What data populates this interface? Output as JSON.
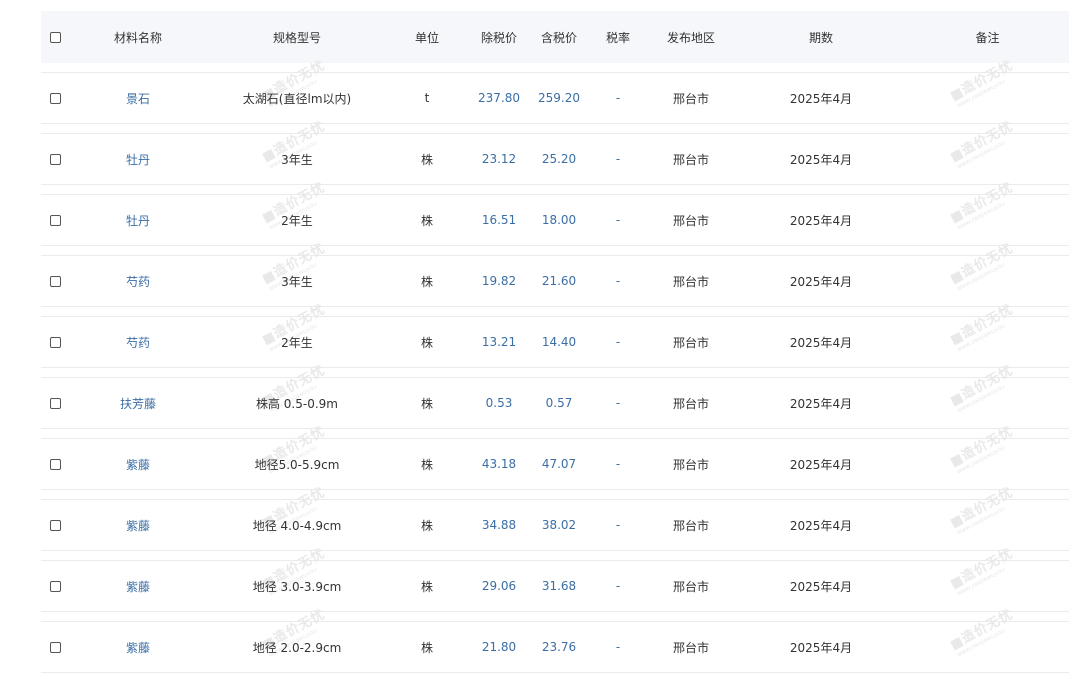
{
  "table": {
    "headers": {
      "name": "材料名称",
      "spec": "规格型号",
      "unit": "单位",
      "price_ex_tax": "除税价",
      "price_in_tax": "含税价",
      "tax_rate": "税率",
      "area": "发布地区",
      "period": "期数",
      "note": "备注"
    },
    "watermark_text": "造价无忧",
    "watermark_sub": "www.zaojiawuyou",
    "rows": [
      {
        "name": "景石",
        "spec": "太湖石(直径lm以内)",
        "unit": "t",
        "price_ex_tax": "237.80",
        "price_in_tax": "259.20",
        "tax_rate": "-",
        "area": "邢台市",
        "period": "2025年4月",
        "note": ""
      },
      {
        "name": "牡丹",
        "spec": "3年生",
        "unit": "株",
        "price_ex_tax": "23.12",
        "price_in_tax": "25.20",
        "tax_rate": "-",
        "area": "邢台市",
        "period": "2025年4月",
        "note": ""
      },
      {
        "name": "牡丹",
        "spec": "2年生",
        "unit": "株",
        "price_ex_tax": "16.51",
        "price_in_tax": "18.00",
        "tax_rate": "-",
        "area": "邢台市",
        "period": "2025年4月",
        "note": ""
      },
      {
        "name": "芍药",
        "spec": "3年生",
        "unit": "株",
        "price_ex_tax": "19.82",
        "price_in_tax": "21.60",
        "tax_rate": "-",
        "area": "邢台市",
        "period": "2025年4月",
        "note": ""
      },
      {
        "name": "芍药",
        "spec": "2年生",
        "unit": "株",
        "price_ex_tax": "13.21",
        "price_in_tax": "14.40",
        "tax_rate": "-",
        "area": "邢台市",
        "period": "2025年4月",
        "note": ""
      },
      {
        "name": "扶芳藤",
        "spec": "株高 0.5-0.9m",
        "unit": "株",
        "price_ex_tax": "0.53",
        "price_in_tax": "0.57",
        "tax_rate": "-",
        "area": "邢台市",
        "period": "2025年4月",
        "note": ""
      },
      {
        "name": "紫藤",
        "spec": "地径5.0-5.9cm",
        "unit": "株",
        "price_ex_tax": "43.18",
        "price_in_tax": "47.07",
        "tax_rate": "-",
        "area": "邢台市",
        "period": "2025年4月",
        "note": ""
      },
      {
        "name": "紫藤",
        "spec": "地径 4.0-4.9cm",
        "unit": "株",
        "price_ex_tax": "34.88",
        "price_in_tax": "38.02",
        "tax_rate": "-",
        "area": "邢台市",
        "period": "2025年4月",
        "note": ""
      },
      {
        "name": "紫藤",
        "spec": "地径 3.0-3.9cm",
        "unit": "株",
        "price_ex_tax": "29.06",
        "price_in_tax": "31.68",
        "tax_rate": "-",
        "area": "邢台市",
        "period": "2025年4月",
        "note": ""
      },
      {
        "name": "紫藤",
        "spec": "地径 2.0-2.9cm",
        "unit": "株",
        "price_ex_tax": "21.80",
        "price_in_tax": "23.76",
        "tax_rate": "-",
        "area": "邢台市",
        "period": "2025年4月",
        "note": ""
      }
    ]
  }
}
